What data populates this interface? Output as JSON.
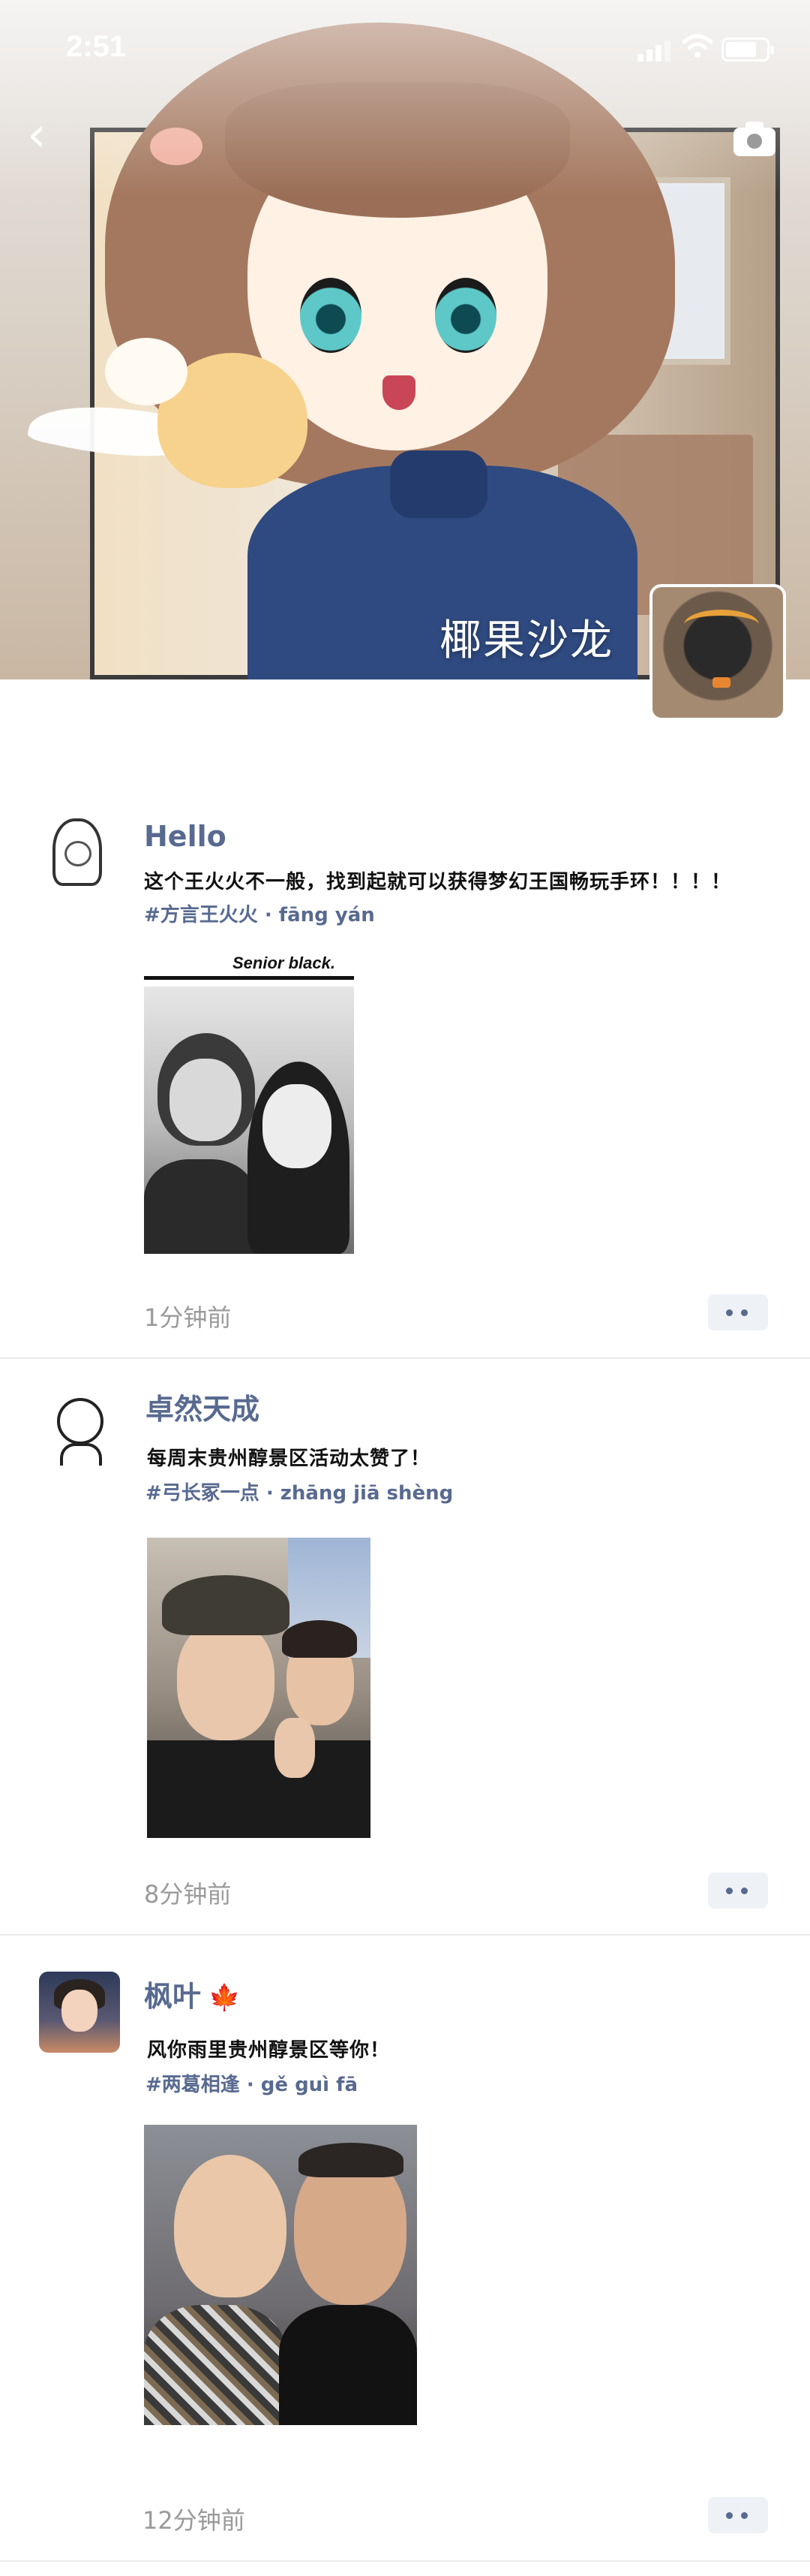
{
  "status_bar": {
    "time": "2:51"
  },
  "cover": {
    "group_name": "椰果沙龙",
    "back_icon": "chevron-left-icon",
    "camera_icon": "camera-icon"
  },
  "posts": [
    {
      "author": "Hello",
      "content": "这个王火火不一般，找到起就可以获得梦幻王国畅玩手环！！！！",
      "tags": "#方言王火火 · fāng yán",
      "photo_caption": "Senior black.",
      "time_ago": "1分钟前"
    },
    {
      "author": "卓然天成",
      "content": "每周末贵州醇景区活动太赞了！",
      "tags": "#弓长冢一点 · zhāng jiā shèng",
      "time_ago": "8分钟前"
    },
    {
      "author": "枫叶",
      "author_emoji": "🍁",
      "content": "风你雨里贵州醇景区等你！",
      "tags": "#两葛相逢 · gě guì fā",
      "time_ago": "12分钟前"
    }
  ],
  "colors": {
    "accent": "#586a90",
    "timestamp": "#9a9a9a",
    "more_button_bg": "#eef1f6"
  }
}
